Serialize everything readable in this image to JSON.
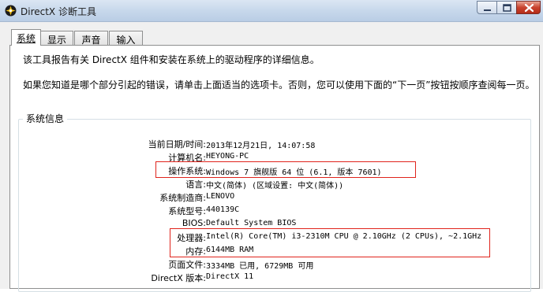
{
  "window": {
    "title": "DirectX 诊断工具",
    "minimize_icon": "minimize-icon",
    "maximize_icon": "maximize-icon",
    "close_icon": "close-icon",
    "app_icon": "directx-icon"
  },
  "tabs": [
    "系统",
    "显示",
    "声音",
    "输入"
  ],
  "active_tab": "系统",
  "intro": {
    "line1": "该工具报告有关 DirectX 组件和安装在系统上的驱动程序的详细信息。",
    "line2": "如果您知道是哪个部分引起的错误，请单击上面适当的选项卡。否则，您可以使用下面的“下一页”按钮按顺序查阅每一页。"
  },
  "system_info": {
    "group_label": "系统信息",
    "rows": [
      {
        "label": "当前日期/时间:",
        "value": "2013年12月21日, 14:07:58"
      },
      {
        "label": "计算机名:",
        "value": "HEYONG-PC"
      },
      {
        "label": "操作系统:",
        "value": "Windows 7 旗舰版 64 位 (6.1, 版本 7601)"
      },
      {
        "label": "语言:",
        "value": "中文(简体) (区域设置: 中文(简体))"
      },
      {
        "label": "系统制造商:",
        "value": "LENOVO"
      },
      {
        "label": "系统型号:",
        "value": "440139C"
      },
      {
        "label": "BIOS:",
        "value": "Default System BIOS"
      },
      {
        "label": "处理器:",
        "value": "Intel(R) Core(TM) i3-2310M CPU @ 2.10GHz (2 CPUs), ~2.1GHz"
      },
      {
        "label": "内存:",
        "value": "6144MB RAM"
      },
      {
        "label": "页面文件:",
        "value": "3334MB 已用, 6729MB 可用"
      },
      {
        "label": "DirectX 版本:",
        "value": "DirectX 11"
      }
    ]
  },
  "colors": {
    "highlight_box": "#e0241c",
    "titlebar": "#c9d9ec",
    "close_button": "#c9432e"
  }
}
